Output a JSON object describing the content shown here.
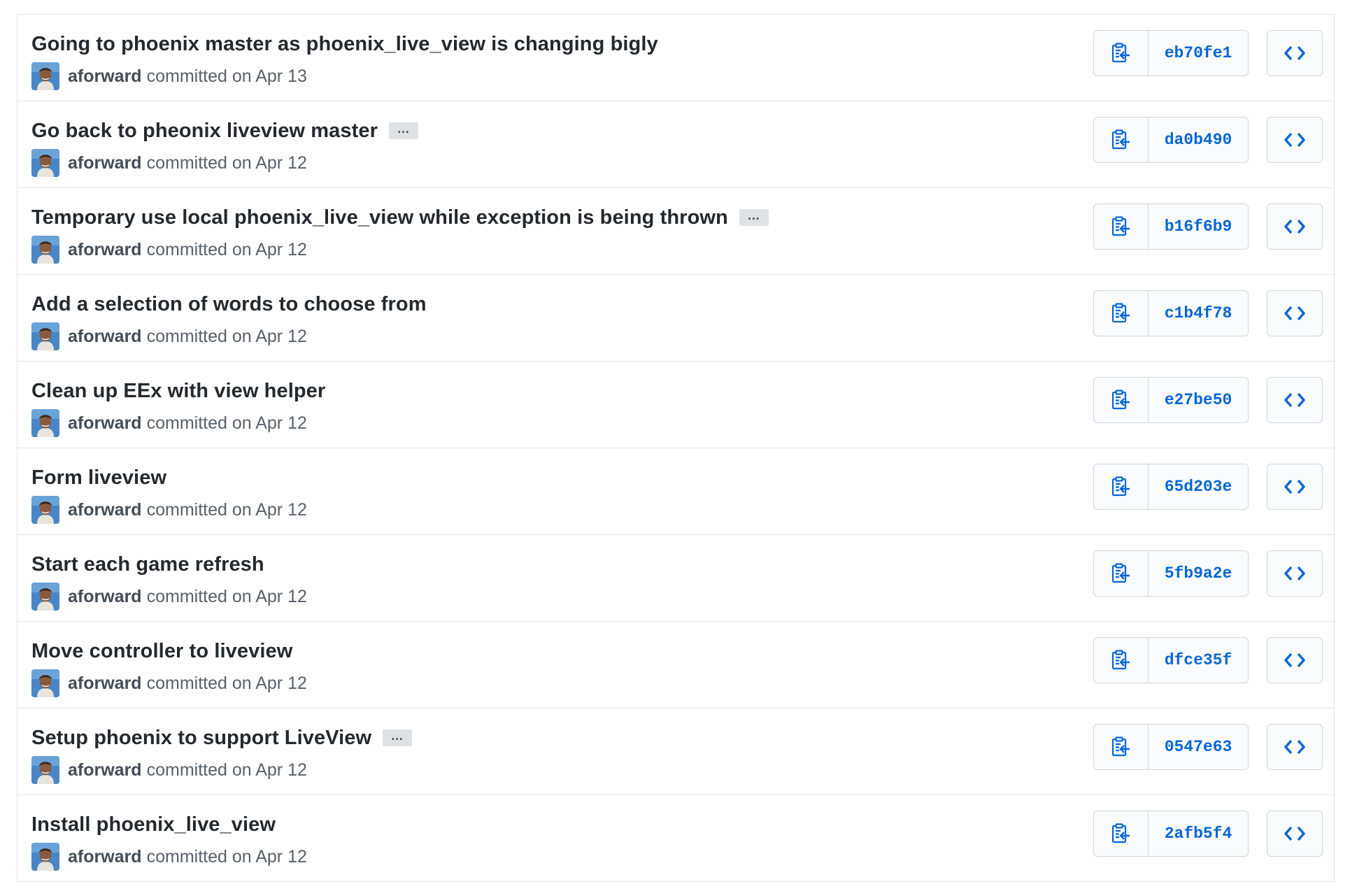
{
  "commits": [
    {
      "title": "Going to phoenix master as phoenix_live_view is changing bigly",
      "has_ellipsis": false,
      "author": "aforward",
      "date_text": "committed on Apr 13",
      "sha": "eb70fe1"
    },
    {
      "title": "Go back to pheonix liveview master",
      "has_ellipsis": true,
      "author": "aforward",
      "date_text": "committed on Apr 12",
      "sha": "da0b490"
    },
    {
      "title": "Temporary use local phoenix_live_view while exception is being thrown",
      "has_ellipsis": true,
      "author": "aforward",
      "date_text": "committed on Apr 12",
      "sha": "b16f6b9"
    },
    {
      "title": "Add a selection of words to choose from",
      "has_ellipsis": false,
      "author": "aforward",
      "date_text": "committed on Apr 12",
      "sha": "c1b4f78"
    },
    {
      "title": "Clean up EEx with view helper",
      "has_ellipsis": false,
      "author": "aforward",
      "date_text": "committed on Apr 12",
      "sha": "e27be50"
    },
    {
      "title": "Form liveview",
      "has_ellipsis": false,
      "author": "aforward",
      "date_text": "committed on Apr 12",
      "sha": "65d203e"
    },
    {
      "title": "Start each game refresh",
      "has_ellipsis": false,
      "author": "aforward",
      "date_text": "committed on Apr 12",
      "sha": "5fb9a2e"
    },
    {
      "title": "Move controller to liveview",
      "has_ellipsis": false,
      "author": "aforward",
      "date_text": "committed on Apr 12",
      "sha": "dfce35f"
    },
    {
      "title": "Setup phoenix to support LiveView",
      "has_ellipsis": true,
      "author": "aforward",
      "date_text": "committed on Apr 12",
      "sha": "0547e63"
    },
    {
      "title": "Install phoenix_live_view",
      "has_ellipsis": false,
      "author": "aforward",
      "date_text": "committed on Apr 12",
      "sha": "2afb5f4"
    }
  ],
  "ellipsis_label": "…",
  "icons": {
    "copy": "clippy-icon",
    "browse": "code-icon"
  },
  "colors": {
    "link": "#0366d6",
    "title": "#24292e",
    "meta": "#586069",
    "border": "#e1e4e8"
  }
}
